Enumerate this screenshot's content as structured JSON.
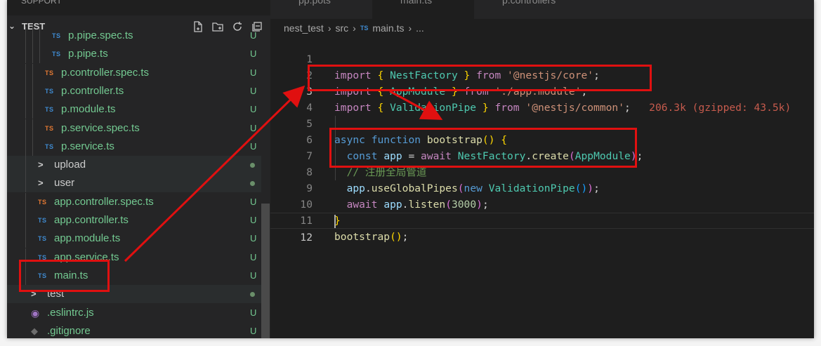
{
  "sidebar": {
    "top_cut_label": "SUPPORT",
    "section_title": "TEST",
    "actions": [
      "new-file-icon",
      "new-folder-icon",
      "refresh-icon",
      "collapse-icon"
    ],
    "items": [
      {
        "name": "p.pipe.spec.ts",
        "icon": "TS",
        "icon_kind": "ts",
        "status": "U",
        "indent": 3
      },
      {
        "name": "p.pipe.ts",
        "icon": "TS",
        "icon_kind": "ts",
        "status": "U",
        "indent": 3
      },
      {
        "name": "p.controller.spec.ts",
        "icon": "TS",
        "icon_kind": "tsx",
        "status": "U",
        "indent": 2
      },
      {
        "name": "p.controller.ts",
        "icon": "TS",
        "icon_kind": "ts",
        "status": "U",
        "indent": 2
      },
      {
        "name": "p.module.ts",
        "icon": "TS",
        "icon_kind": "ts",
        "status": "U",
        "indent": 2
      },
      {
        "name": "p.service.spec.ts",
        "icon": "TS",
        "icon_kind": "tsx",
        "status": "U",
        "indent": 2
      },
      {
        "name": "p.service.ts",
        "icon": "TS",
        "icon_kind": "ts",
        "status": "U",
        "indent": 2
      },
      {
        "name": "upload",
        "icon": ">",
        "icon_kind": "fold",
        "status": "dot",
        "indent": 1
      },
      {
        "name": "user",
        "icon": ">",
        "icon_kind": "fold",
        "status": "dot",
        "indent": 1
      },
      {
        "name": "app.controller.spec.ts",
        "icon": "TS",
        "icon_kind": "tsx",
        "status": "U",
        "indent": 1
      },
      {
        "name": "app.controller.ts",
        "icon": "TS",
        "icon_kind": "ts",
        "status": "U",
        "indent": 1
      },
      {
        "name": "app.module.ts",
        "icon": "TS",
        "icon_kind": "ts",
        "status": "U",
        "indent": 1
      },
      {
        "name": "app.service.ts",
        "icon": "TS",
        "icon_kind": "ts",
        "status": "U",
        "indent": 1
      },
      {
        "name": "main.ts",
        "icon": "TS",
        "icon_kind": "ts",
        "status": "U",
        "indent": 1
      },
      {
        "name": "test",
        "icon": ">",
        "icon_kind": "fold",
        "status": "dot",
        "indent": 0
      },
      {
        "name": ".eslintrc.js",
        "icon": "◉",
        "icon_kind": "js",
        "status": "U",
        "indent": 0
      },
      {
        "name": ".gitignore",
        "icon": "◆",
        "icon_kind": "git",
        "status": "U",
        "indent": 0
      }
    ]
  },
  "editor": {
    "tabs": [
      "pp.pots",
      "main.ts",
      "p.controllers"
    ],
    "breadcrumb": {
      "parts": [
        "nest_test",
        "src",
        "main.ts",
        "..."
      ],
      "ts_badge": "TS"
    },
    "line_numbers": [
      "1",
      "2",
      "3",
      "4",
      "5",
      "6",
      "7",
      "8",
      "9",
      "10",
      "11",
      "12"
    ],
    "code": {
      "l1": {
        "kw": "import",
        "o": " { ",
        "id": "NestFactory",
        "c": " } ",
        "from": "from",
        "sp": " ",
        "str": "'@nestjs/core'",
        "end": ";"
      },
      "l2": {
        "kw": "import",
        "o": " { ",
        "id": "AppModule",
        "c": " } ",
        "from": "from",
        "sp": " ",
        "str": "'./app.module'",
        "end": ";"
      },
      "l3": {
        "kw": "import",
        "o": " { ",
        "id": "ValidationPipe",
        "c": " } ",
        "from": "from",
        "sp": " ",
        "str": "'@nestjs/common'",
        "end": ";",
        "hint": "206.3k (gzipped: 43.5k)"
      },
      "l5": {
        "async": "async",
        "function": "function",
        "name": "bootstrap",
        "params": "()",
        "open": " {"
      },
      "l6": {
        "const": "const",
        "var": "app",
        "eq": " = ",
        "await": "await",
        "cls": "NestFactory",
        "dot": ".",
        "fn": "create",
        "p1": "(",
        "arg": "AppModule",
        "p2": ")",
        "end": ";"
      },
      "l7": {
        "comment": "// 注册全局管道"
      },
      "l8": {
        "obj": "app",
        "dot": ".",
        "fn": "useGlobalPipes",
        "p1": "(",
        "new": "new",
        "cls": "ValidationPipe",
        "p2": "()",
        "p3": ")",
        "end": ";"
      },
      "l9": {
        "await": "await",
        "obj": "app",
        "dot": ".",
        "fn": "listen",
        "p1": "(",
        "num": "3000",
        "p2": ")",
        "end": ";"
      },
      "l10": {
        "close": "}"
      },
      "l11": {
        "fn": "bootstrap",
        "call": "()",
        "end": ";"
      }
    }
  },
  "colors": {
    "annotation": "#e01010",
    "untracked": "#73c991",
    "ts_icon": "#3f8bd1"
  }
}
